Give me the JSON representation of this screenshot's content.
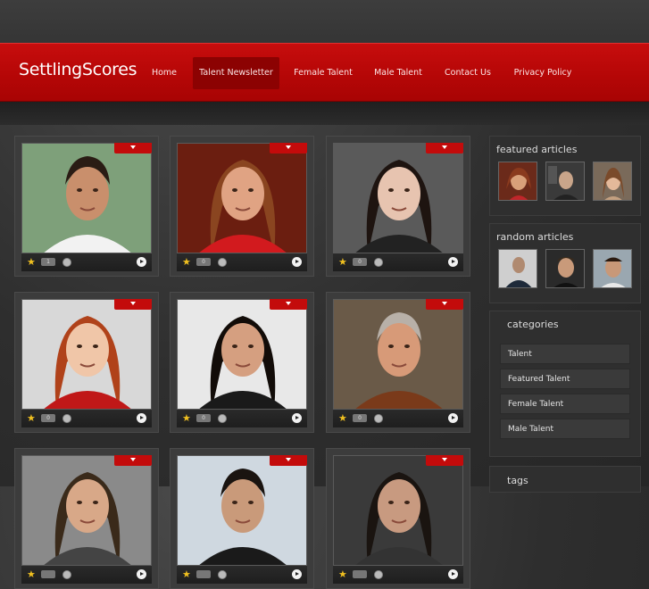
{
  "site": {
    "logo": "SettlingScores"
  },
  "nav": [
    {
      "label": "Home",
      "active": false
    },
    {
      "label": "Talent Newsletter",
      "active": true
    },
    {
      "label": "Female Talent",
      "active": false
    },
    {
      "label": "Male Talent",
      "active": false
    },
    {
      "label": "Contact Us",
      "active": false
    },
    {
      "label": "Privacy Policy",
      "active": false
    }
  ],
  "cards": [
    {
      "comments": "1"
    },
    {
      "comments": "0"
    },
    {
      "comments": "0"
    },
    {
      "comments": "0"
    },
    {
      "comments": "0"
    },
    {
      "comments": "0"
    },
    {
      "comments": ""
    },
    {
      "comments": ""
    },
    {
      "comments": ""
    }
  ],
  "sidebar": {
    "featured_title": "featured articles",
    "random_title": "random articles",
    "categories_title": "categories",
    "categories": [
      "Talent",
      "Featured Talent",
      "Female Talent",
      "Male Talent"
    ],
    "tags_title": "tags"
  },
  "colors": {
    "accent": "#c30b0b",
    "header": "#b40606",
    "panel": "#3c3c3c"
  }
}
